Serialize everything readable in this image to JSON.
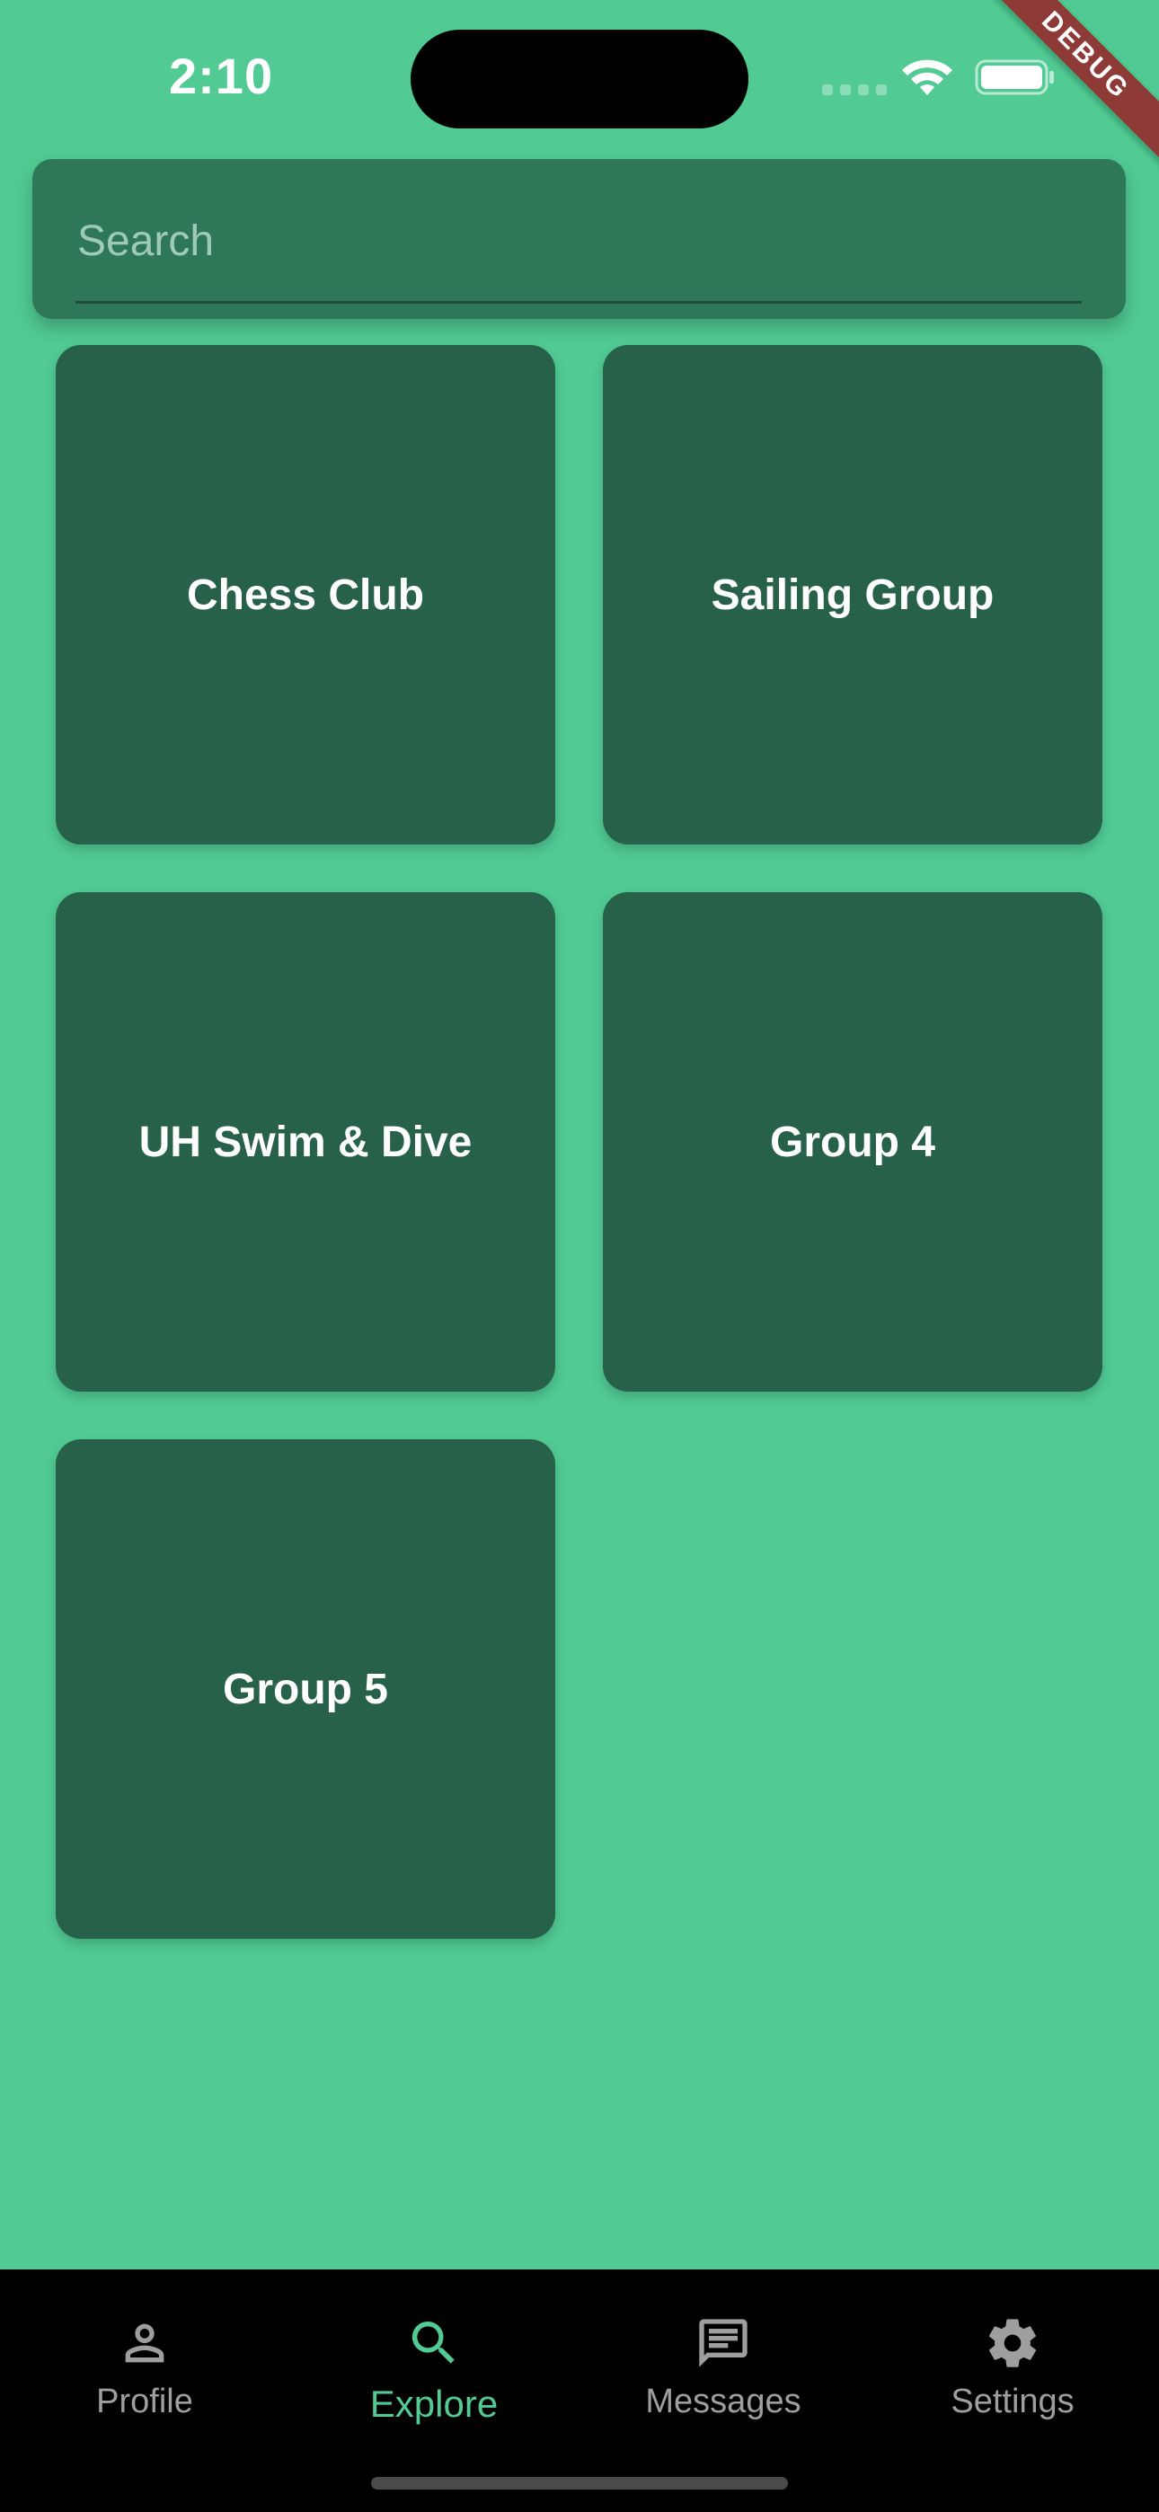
{
  "status_bar": {
    "time": "2:10",
    "debug_banner": "DEBUG"
  },
  "search": {
    "placeholder": "Search",
    "value": ""
  },
  "groups": [
    {
      "label": "Chess Club"
    },
    {
      "label": "Sailing Group"
    },
    {
      "label": "UH Swim & Dive"
    },
    {
      "label": "Group 4"
    },
    {
      "label": "Group 5"
    }
  ],
  "bottom_nav": {
    "active": "Explore",
    "items": [
      {
        "label": "Profile",
        "icon": "person-icon"
      },
      {
        "label": "Explore",
        "icon": "search-icon"
      },
      {
        "label": "Messages",
        "icon": "message-icon"
      },
      {
        "label": "Settings",
        "icon": "gear-icon"
      }
    ]
  },
  "colors": {
    "background": "#51ca93",
    "tile": "#27614a",
    "search_card": "#2e7858",
    "nav_active": "#51ca93",
    "nav_inactive": "#9e9e9e",
    "debug_ribbon": "#8e3a36"
  }
}
